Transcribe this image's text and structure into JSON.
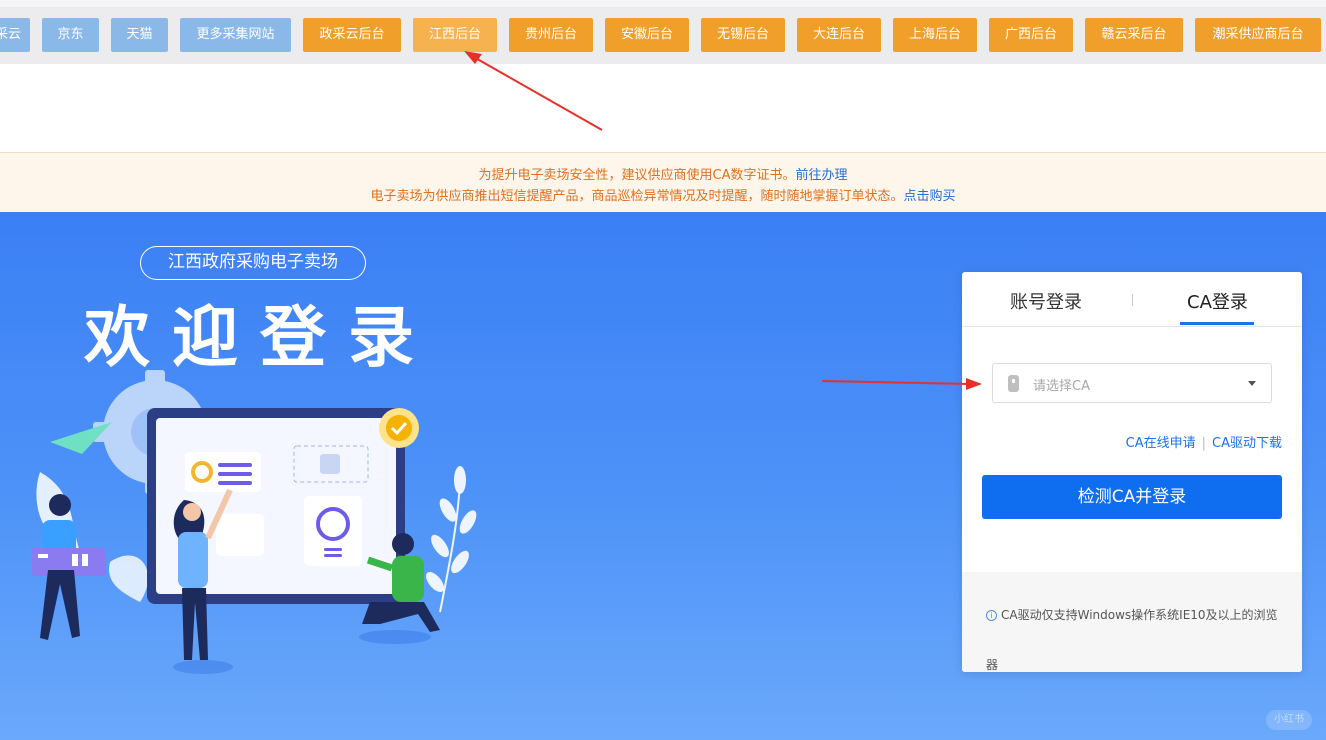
{
  "nav": {
    "items": [
      {
        "label": "采云",
        "style": "blue"
      },
      {
        "label": "京东",
        "style": "blue"
      },
      {
        "label": "天猫",
        "style": "blue"
      },
      {
        "label": "更多采集网站",
        "style": "blue"
      },
      {
        "label": "政采云后台",
        "style": "orange"
      },
      {
        "label": "江西后台",
        "style": "active"
      },
      {
        "label": "贵州后台",
        "style": "orange"
      },
      {
        "label": "安徽后台",
        "style": "orange"
      },
      {
        "label": "无锡后台",
        "style": "orange"
      },
      {
        "label": "大连后台",
        "style": "orange"
      },
      {
        "label": "上海后台",
        "style": "orange"
      },
      {
        "label": "广西后台",
        "style": "orange"
      },
      {
        "label": "赣云采后台",
        "style": "orange"
      },
      {
        "label": "潮采供应商后台",
        "style": "orange"
      }
    ]
  },
  "notice": {
    "line1_text": "为提升电子卖场安全性，建议供应商使用CA数字证书。",
    "line1_link": "前往办理",
    "line2_text": "电子卖场为供应商推出短信提醒产品，商品巡检异常情况及时提醒，随时随地掌握订单状态。",
    "line2_link": "点击购买"
  },
  "hero": {
    "pill": "江西政府采购电子卖场",
    "welcome": "欢迎登录",
    "badge": "小红书"
  },
  "login": {
    "tab_account": "账号登录",
    "tab_ca": "CA登录",
    "select_placeholder": "请选择CA",
    "link_apply": "CA在线申请",
    "link_download": "CA驱动下载",
    "submit": "检测CA并登录",
    "tip": "CA驱动仅支持Windows操作系统IE10及以上的浏览器"
  },
  "colors": {
    "nav_blue": "#8ab9e9",
    "nav_orange": "#f0a02a",
    "primary": "#0f6ef0",
    "hero_bg": "#3b7ff5",
    "arrow": "#e8302a"
  }
}
